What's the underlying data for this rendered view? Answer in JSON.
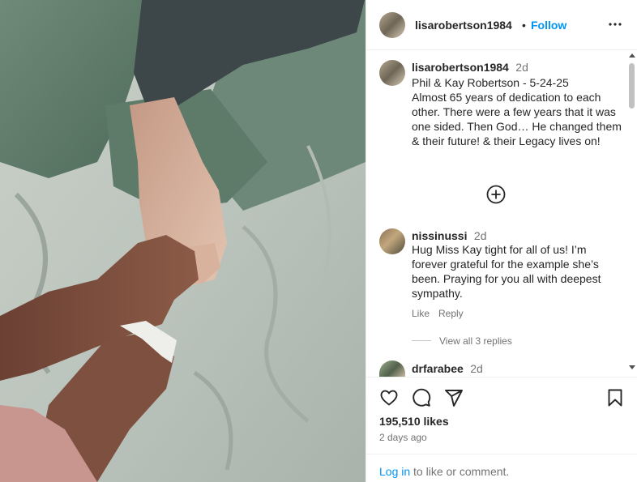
{
  "post": {
    "username": "lisarobertson1984",
    "separator": "•",
    "follow_label": "Follow",
    "more_icon": "more-horizontal-icon"
  },
  "caption": {
    "username": "lisarobertson1984",
    "time": "2d",
    "text": "Phil & Kay Robertson - 5-24-25\nAlmost 65 years of dedication to each other. There were a few years that it was one sided. Then God… He changed them & their future! & their Legacy lives on!"
  },
  "comments": [
    {
      "username": "nissinussi",
      "time": "2d",
      "text": "Hug Miss Kay tight for all of us! I’m forever grateful for the example she’s been. Praying for you all with deepest sympathy.",
      "like_label": "Like",
      "reply_label": "Reply",
      "view_replies": "View all 3 replies"
    },
    {
      "username": "drfarabee",
      "time": "2d"
    }
  ],
  "actions": {
    "like_icon": "heart-icon",
    "comment_icon": "comment-icon",
    "share_icon": "send-icon",
    "save_icon": "bookmark-icon"
  },
  "likes": "195,510 likes",
  "posted": "2 days ago",
  "login": {
    "link": "Log in",
    "text": " to like or comment."
  }
}
